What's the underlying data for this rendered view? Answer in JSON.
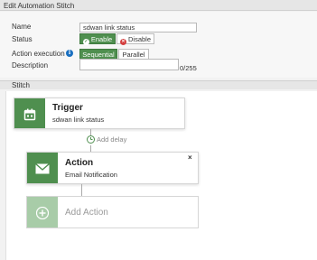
{
  "header": {
    "title": "Edit Automation Stitch"
  },
  "form": {
    "name_label": "Name",
    "name_value": "sdwan link status",
    "status_label": "Status",
    "enable_label": "Enable",
    "disable_label": "Disable",
    "action_execution_label": "Action execution",
    "info_glyph": "i",
    "sequential_label": "Sequential",
    "parallel_label": "Parallel",
    "description_label": "Description",
    "description_value": "",
    "description_count": "0/255"
  },
  "stitch": {
    "section_title": "Stitch",
    "trigger": {
      "title": "Trigger",
      "subtitle": "sdwan link status",
      "icon": "calendar-icon"
    },
    "add_delay_label": "Add delay",
    "action": {
      "title": "Action",
      "subtitle": "Email Notification",
      "icon": "envelope-icon",
      "close_glyph": "×"
    },
    "add_action": {
      "title": "Add Action",
      "icon": "plus-icon"
    }
  },
  "colors": {
    "accent_green": "#4f8f4f",
    "light_green": "#a8cca8",
    "disable_red": "#d43f3f",
    "info_blue": "#1a6fc0"
  }
}
